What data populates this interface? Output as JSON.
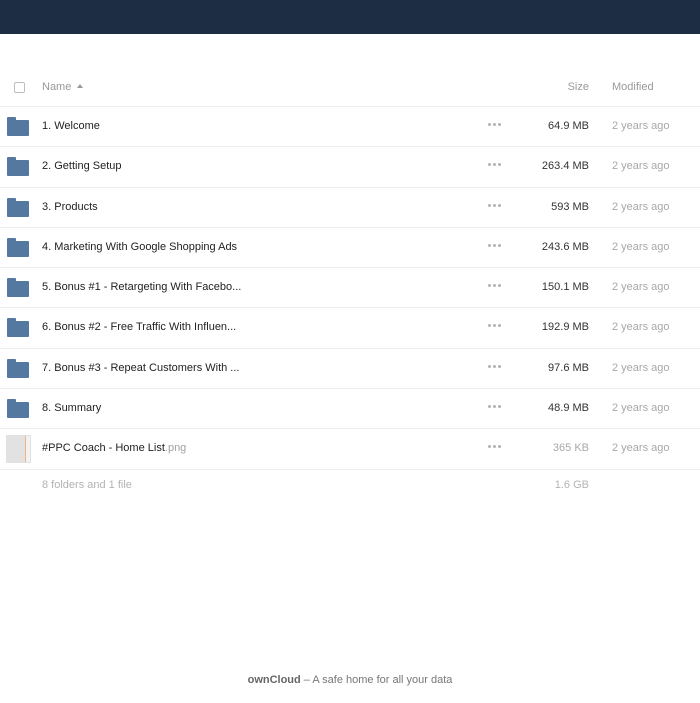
{
  "header": {
    "name_label": "Name",
    "size_label": "Size",
    "modified_label": "Modified"
  },
  "files": [
    {
      "name": "1. Welcome",
      "ext": "",
      "type": "folder",
      "size": "64.9 MB",
      "modified": "2 years ago"
    },
    {
      "name": "2. Getting Setup",
      "ext": "",
      "type": "folder",
      "size": "263.4 MB",
      "modified": "2 years ago"
    },
    {
      "name": "3. Products",
      "ext": "",
      "type": "folder",
      "size": "593 MB",
      "modified": "2 years ago"
    },
    {
      "name": "4. Marketing With Google Shopping Ads",
      "ext": "",
      "type": "folder",
      "size": "243.6 MB",
      "modified": "2 years ago"
    },
    {
      "name": "5. Bonus #1 - Retargeting With Facebo...",
      "ext": "",
      "type": "folder",
      "size": "150.1 MB",
      "modified": "2 years ago"
    },
    {
      "name": "6. Bonus #2 - Free Traffic With Influen...",
      "ext": "",
      "type": "folder",
      "size": "192.9 MB",
      "modified": "2 years ago"
    },
    {
      "name": "7. Bonus #3 - Repeat Customers With ...",
      "ext": "",
      "type": "folder",
      "size": "97.6 MB",
      "modified": "2 years ago"
    },
    {
      "name": "8. Summary",
      "ext": "",
      "type": "folder",
      "size": "48.9 MB",
      "modified": "2 years ago"
    },
    {
      "name": "#PPC Coach - Home List",
      "ext": ".png",
      "type": "file",
      "size": "365 KB",
      "modified": "2 years ago"
    }
  ],
  "summary": {
    "text": "8 folders and 1 file",
    "total_size": "1.6 GB"
  },
  "footer": {
    "brand": "ownCloud",
    "tagline": " – A safe home for all your data"
  },
  "colors": {
    "topbar": "#1d2d44",
    "folder": "#5578a0"
  }
}
